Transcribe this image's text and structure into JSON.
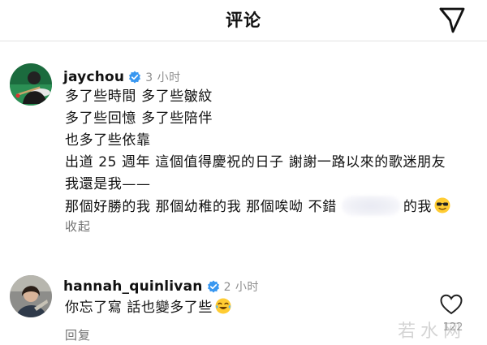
{
  "header": {
    "title": "评论",
    "send_icon": "paper-plane-icon"
  },
  "comments": [
    {
      "username": "jaychou",
      "verified": true,
      "time": "3 小时",
      "lines": [
        "多了些時間 多了些皺紋",
        "多了些回憶 多了些陪伴",
        "也多了些依靠",
        "出道 25 週年 這個值得慶祝的日子 謝謝一路以來的歌迷朋友",
        "我還是我——"
      ],
      "last_line": {
        "before_blur": "那個好勝的我 那個幼稚的我 那個唉呦 不錯",
        "after_blur": "的我",
        "emoji": "sunglasses-emoji"
      },
      "action": "收起"
    },
    {
      "username": "hannah_quinlivan",
      "verified": true,
      "time": "2 小时",
      "text": "你忘了寫 話也變多了些",
      "emoji": "tears-of-joy-emoji",
      "action": "回复",
      "like_count": "122",
      "like_icon": "heart-outline-icon"
    }
  ],
  "watermark": "若水网",
  "colors": {
    "verified": "#3897f0",
    "secondary_text": "#8e8e8e",
    "primary_text": "#111111"
  }
}
